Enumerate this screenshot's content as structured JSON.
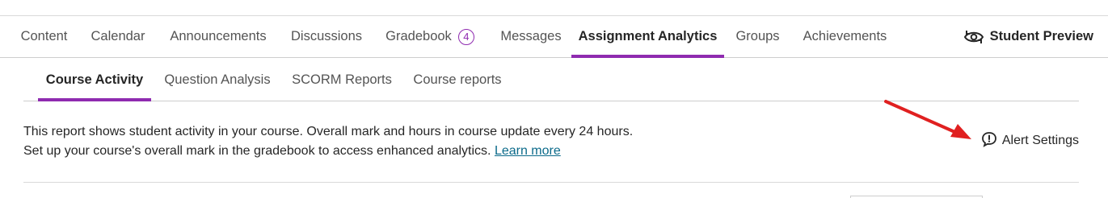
{
  "nav": {
    "items": [
      {
        "label": "Content"
      },
      {
        "label": "Calendar"
      },
      {
        "label": "Announcements"
      },
      {
        "label": "Discussions"
      },
      {
        "label": "Gradebook",
        "badge": "4"
      },
      {
        "label": "Messages"
      },
      {
        "label": "Assignment Analytics",
        "active": true
      },
      {
        "label": "Groups"
      },
      {
        "label": "Achievements"
      }
    ],
    "student_preview": "Student Preview"
  },
  "tabs": [
    {
      "label": "Course Activity",
      "active": true
    },
    {
      "label": "Question Analysis"
    },
    {
      "label": "SCORM Reports"
    },
    {
      "label": "Course reports"
    }
  ],
  "description": {
    "line1": "This report shows student activity in your course. Overall mark and hours in course update every 24 hours.",
    "line2": "Set up your course's overall mark in the gradebook to access enhanced analytics.",
    "link": "Learn more"
  },
  "alert_settings": {
    "label": "Alert Settings",
    "icon": "alert-bubble-icon"
  },
  "colors": {
    "accent": "#8f2bb0",
    "link": "#0b6a8a",
    "annotation_arrow": "#e02020"
  }
}
